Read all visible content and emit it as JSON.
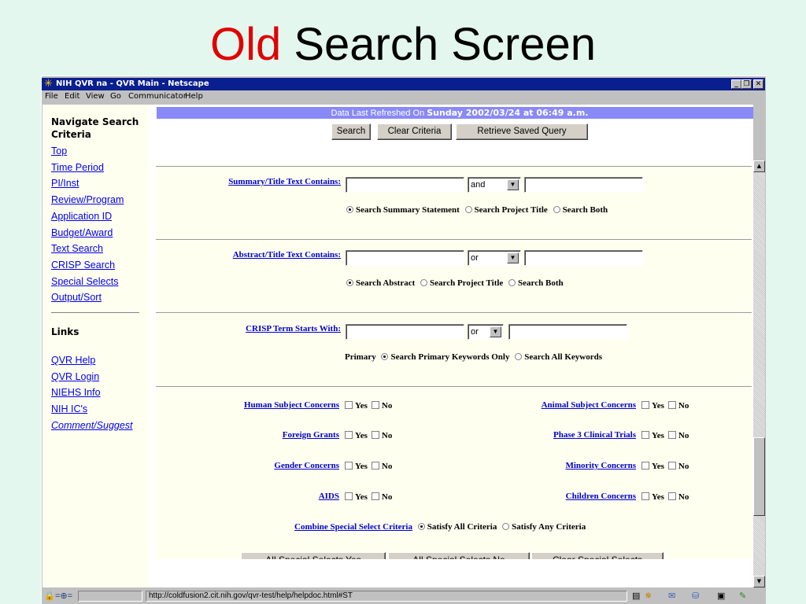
{
  "slide": {
    "title_old": "Old",
    "title_rest": "Search Screen"
  },
  "window": {
    "title": "NIH QVR na - QVR Main - Netscape",
    "menu": [
      "File",
      "Edit",
      "View",
      "Go",
      "Communicator",
      "Help"
    ],
    "controls": {
      "minimize": "_",
      "maximize": "❐",
      "close": "✕"
    }
  },
  "sidebar": {
    "heading_line1": "Navigate Search",
    "heading_line2": "Criteria",
    "nav": [
      "Top",
      "Time Period",
      "PI/Inst",
      "Review/Program",
      "Application ID",
      "Budget/Award",
      "Text Search",
      "CRISP Search",
      "Special Selects",
      "Output/Sort"
    ],
    "links_heading": "Links",
    "links": [
      "QVR Help",
      "QVR Login",
      "NIEHS Info",
      "NIH IC's",
      "Comment/Suggest"
    ]
  },
  "banner": {
    "prefix": "Data Last Refreshed On",
    "date": "Sunday 2002/03/24 at 06:49 a.m."
  },
  "toolbar": {
    "search": "Search",
    "clear": "Clear Criteria",
    "retrieve": "Retrieve Saved Query"
  },
  "summary": {
    "label": "Summary/Title Text Contains:",
    "operator": "and",
    "options": [
      "Search Summary Statement",
      "Search Project Title",
      "Search Both"
    ],
    "selected": 0
  },
  "abstract": {
    "label": "Abstract/Title Text Contains:",
    "operator": "or",
    "options": [
      "Search Abstract",
      "Search Project Title",
      "Search Both"
    ],
    "selected": 0
  },
  "crisp": {
    "label": "CRISP Term Starts With:",
    "operator": "or",
    "prefix": "Primary",
    "options": [
      "Search Primary Keywords Only",
      "Search All Keywords"
    ],
    "selected": 0
  },
  "special": {
    "yes": "Yes",
    "no": "No",
    "left": [
      "Human Subject Concerns",
      "Foreign Grants",
      "Gender Concerns",
      "AIDS"
    ],
    "right": [
      "Animal Subject Concerns",
      "Phase 3 Clinical Trials",
      "Minority Concerns",
      "Children Concerns"
    ],
    "combine_label": "Combine Special Select Criteria",
    "combine_options": [
      "Satisfy All Criteria",
      "Satisfy Any Criteria"
    ],
    "combine_selected": 0,
    "buttons": [
      "All Special Selects Yes",
      "All Special Selects No",
      "Clear Special Selects"
    ]
  },
  "status": {
    "url": "http://coldfusion2.cit.nih.gov/qvr-test/help/helpdoc.html#ST"
  }
}
